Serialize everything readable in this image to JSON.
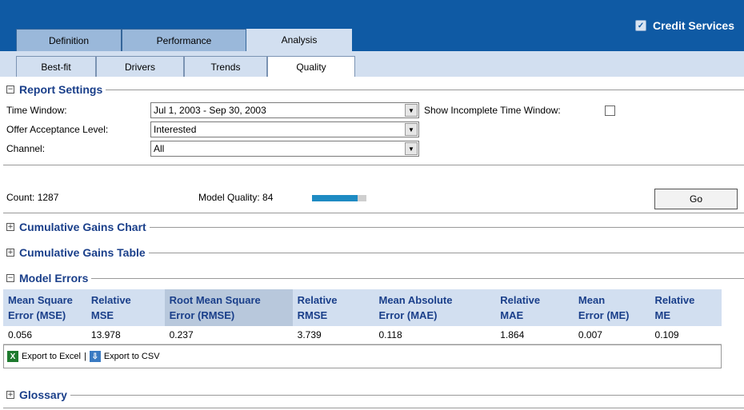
{
  "app": {
    "title": "Credit Services"
  },
  "tabs_level1": [
    {
      "label": "Definition",
      "active": false
    },
    {
      "label": "Performance",
      "active": false
    },
    {
      "label": "Analysis",
      "active": true
    }
  ],
  "tabs_level2": [
    {
      "label": "Best-fit",
      "active": false
    },
    {
      "label": "Drivers",
      "active": false
    },
    {
      "label": "Trends",
      "active": false
    },
    {
      "label": "Quality",
      "active": true
    }
  ],
  "report_settings": {
    "title": "Report Settings",
    "time_window": {
      "label": "Time Window:",
      "value": "Jul 1, 2003 - Sep 30, 2003"
    },
    "show_incomplete": {
      "label": "Show Incomplete Time Window:",
      "checked": false
    },
    "offer_acceptance": {
      "label": "Offer Acceptance Level:",
      "value": "Interested"
    },
    "channel": {
      "label": "Channel:",
      "value": "All"
    }
  },
  "summary": {
    "count_text": "Count: 1287",
    "model_quality_text": "Model Quality: 84",
    "model_quality_value": 84,
    "go_label": "Go"
  },
  "sections": {
    "cumulative_gains_chart": "Cumulative Gains Chart",
    "cumulative_gains_table": "Cumulative Gains Table",
    "model_errors": "Model Errors",
    "glossary": "Glossary"
  },
  "model_errors": {
    "headers": [
      [
        "Mean Square",
        "Error (MSE)"
      ],
      [
        "Relative",
        "MSE"
      ],
      [
        "Root Mean Square",
        "Error (RMSE)"
      ],
      [
        "Relative",
        "RMSE"
      ],
      [
        "Mean Absolute",
        "Error (MAE)"
      ],
      [
        "Relative",
        "MAE"
      ],
      [
        "Mean",
        "Error (ME)"
      ],
      [
        "Relative",
        "ME"
      ]
    ],
    "values": [
      "0.056",
      "13.978",
      "0.237",
      "3.739",
      "0.118",
      "1.864",
      "0.007",
      "0.109"
    ]
  },
  "export": {
    "excel_label": "Export to Excel",
    "separator": "|",
    "csv_label": "Export to CSV"
  },
  "colors": {
    "header_blue": "#0f5aa4",
    "tab_light": "#d2dff0",
    "section_title": "#1a3f8a",
    "quality_fill": "#1e8bc3"
  }
}
